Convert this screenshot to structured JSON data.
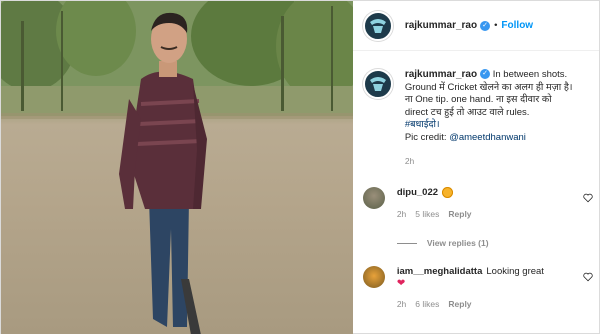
{
  "post": {
    "username": "rajkummar_rao",
    "follow_label": "Follow",
    "caption": "In between shots. Ground में Cricket खेलने का अलग ही मज़ा है। ना One tip. one hand. ना इस दीवार को direct टच हुई तो आउट वाले rules.",
    "hashtag": "#बधाईदो।",
    "credit_label": "Pic credit: ",
    "credit_handle": "@ameetdhanwani",
    "time": "2h"
  },
  "comments": [
    {
      "username": "dipu_022",
      "text": "",
      "emoji": "heart-eyes-emoji",
      "time": "2h",
      "likes": "5 likes",
      "reply_label": "Reply",
      "view_replies": "View replies (1)"
    },
    {
      "username": "iam__meghalidatta",
      "text": "Looking great",
      "emoji": "red-heart-emoji",
      "time": "2h",
      "likes": "6 likes",
      "reply_label": "Reply"
    }
  ],
  "colors": {
    "link": "#0095f6",
    "verified": "#3897f0",
    "muted": "#8e8e8e",
    "hashtag": "#00376b"
  }
}
